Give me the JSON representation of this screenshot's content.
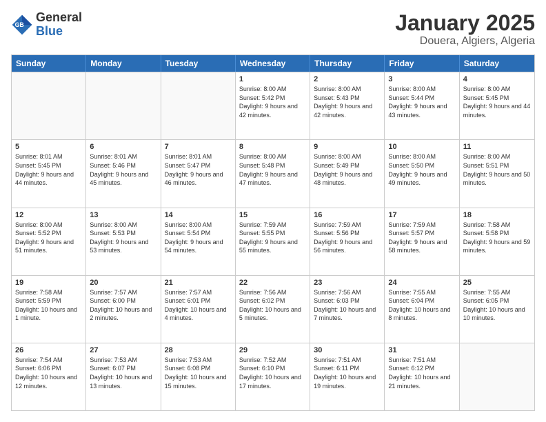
{
  "logo": {
    "line1": "General",
    "line2": "Blue"
  },
  "title": "January 2025",
  "subtitle": "Douera, Algiers, Algeria",
  "days": [
    "Sunday",
    "Monday",
    "Tuesday",
    "Wednesday",
    "Thursday",
    "Friday",
    "Saturday"
  ],
  "weeks": [
    [
      {
        "day": "",
        "info": ""
      },
      {
        "day": "",
        "info": ""
      },
      {
        "day": "",
        "info": ""
      },
      {
        "day": "1",
        "info": "Sunrise: 8:00 AM\nSunset: 5:42 PM\nDaylight: 9 hours and 42 minutes."
      },
      {
        "day": "2",
        "info": "Sunrise: 8:00 AM\nSunset: 5:43 PM\nDaylight: 9 hours and 42 minutes."
      },
      {
        "day": "3",
        "info": "Sunrise: 8:00 AM\nSunset: 5:44 PM\nDaylight: 9 hours and 43 minutes."
      },
      {
        "day": "4",
        "info": "Sunrise: 8:00 AM\nSunset: 5:45 PM\nDaylight: 9 hours and 44 minutes."
      }
    ],
    [
      {
        "day": "5",
        "info": "Sunrise: 8:01 AM\nSunset: 5:45 PM\nDaylight: 9 hours and 44 minutes."
      },
      {
        "day": "6",
        "info": "Sunrise: 8:01 AM\nSunset: 5:46 PM\nDaylight: 9 hours and 45 minutes."
      },
      {
        "day": "7",
        "info": "Sunrise: 8:01 AM\nSunset: 5:47 PM\nDaylight: 9 hours and 46 minutes."
      },
      {
        "day": "8",
        "info": "Sunrise: 8:00 AM\nSunset: 5:48 PM\nDaylight: 9 hours and 47 minutes."
      },
      {
        "day": "9",
        "info": "Sunrise: 8:00 AM\nSunset: 5:49 PM\nDaylight: 9 hours and 48 minutes."
      },
      {
        "day": "10",
        "info": "Sunrise: 8:00 AM\nSunset: 5:50 PM\nDaylight: 9 hours and 49 minutes."
      },
      {
        "day": "11",
        "info": "Sunrise: 8:00 AM\nSunset: 5:51 PM\nDaylight: 9 hours and 50 minutes."
      }
    ],
    [
      {
        "day": "12",
        "info": "Sunrise: 8:00 AM\nSunset: 5:52 PM\nDaylight: 9 hours and 51 minutes."
      },
      {
        "day": "13",
        "info": "Sunrise: 8:00 AM\nSunset: 5:53 PM\nDaylight: 9 hours and 53 minutes."
      },
      {
        "day": "14",
        "info": "Sunrise: 8:00 AM\nSunset: 5:54 PM\nDaylight: 9 hours and 54 minutes."
      },
      {
        "day": "15",
        "info": "Sunrise: 7:59 AM\nSunset: 5:55 PM\nDaylight: 9 hours and 55 minutes."
      },
      {
        "day": "16",
        "info": "Sunrise: 7:59 AM\nSunset: 5:56 PM\nDaylight: 9 hours and 56 minutes."
      },
      {
        "day": "17",
        "info": "Sunrise: 7:59 AM\nSunset: 5:57 PM\nDaylight: 9 hours and 58 minutes."
      },
      {
        "day": "18",
        "info": "Sunrise: 7:58 AM\nSunset: 5:58 PM\nDaylight: 9 hours and 59 minutes."
      }
    ],
    [
      {
        "day": "19",
        "info": "Sunrise: 7:58 AM\nSunset: 5:59 PM\nDaylight: 10 hours and 1 minute."
      },
      {
        "day": "20",
        "info": "Sunrise: 7:57 AM\nSunset: 6:00 PM\nDaylight: 10 hours and 2 minutes."
      },
      {
        "day": "21",
        "info": "Sunrise: 7:57 AM\nSunset: 6:01 PM\nDaylight: 10 hours and 4 minutes."
      },
      {
        "day": "22",
        "info": "Sunrise: 7:56 AM\nSunset: 6:02 PM\nDaylight: 10 hours and 5 minutes."
      },
      {
        "day": "23",
        "info": "Sunrise: 7:56 AM\nSunset: 6:03 PM\nDaylight: 10 hours and 7 minutes."
      },
      {
        "day": "24",
        "info": "Sunrise: 7:55 AM\nSunset: 6:04 PM\nDaylight: 10 hours and 8 minutes."
      },
      {
        "day": "25",
        "info": "Sunrise: 7:55 AM\nSunset: 6:05 PM\nDaylight: 10 hours and 10 minutes."
      }
    ],
    [
      {
        "day": "26",
        "info": "Sunrise: 7:54 AM\nSunset: 6:06 PM\nDaylight: 10 hours and 12 minutes."
      },
      {
        "day": "27",
        "info": "Sunrise: 7:53 AM\nSunset: 6:07 PM\nDaylight: 10 hours and 13 minutes."
      },
      {
        "day": "28",
        "info": "Sunrise: 7:53 AM\nSunset: 6:08 PM\nDaylight: 10 hours and 15 minutes."
      },
      {
        "day": "29",
        "info": "Sunrise: 7:52 AM\nSunset: 6:10 PM\nDaylight: 10 hours and 17 minutes."
      },
      {
        "day": "30",
        "info": "Sunrise: 7:51 AM\nSunset: 6:11 PM\nDaylight: 10 hours and 19 minutes."
      },
      {
        "day": "31",
        "info": "Sunrise: 7:51 AM\nSunset: 6:12 PM\nDaylight: 10 hours and 21 minutes."
      },
      {
        "day": "",
        "info": ""
      }
    ]
  ]
}
